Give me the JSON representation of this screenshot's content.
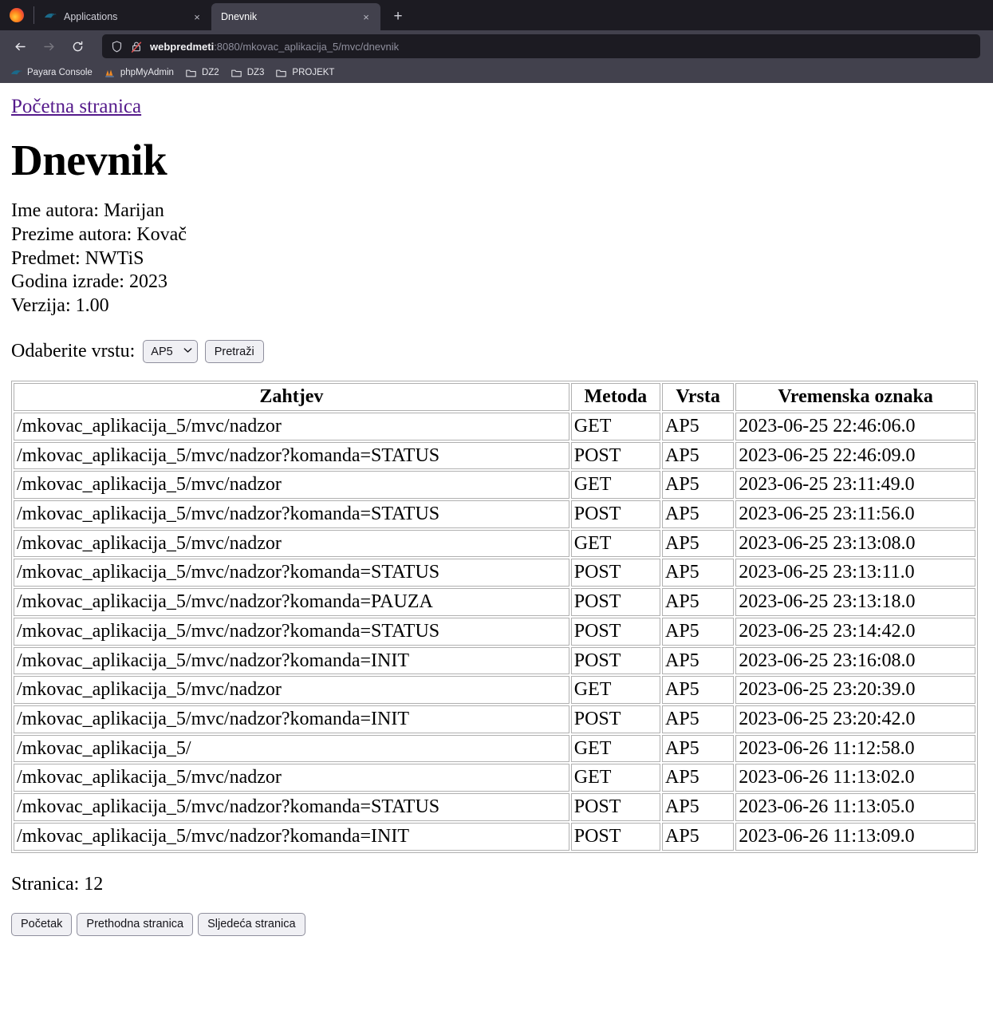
{
  "browser": {
    "app_icon": "firefox-logo",
    "tabs": [
      {
        "title": "Applications",
        "favicon": "payara-favicon",
        "active": false,
        "close_label": "×"
      },
      {
        "title": "Dnevnik",
        "favicon": "none",
        "active": true,
        "close_label": "×"
      }
    ],
    "new_tab_label": "+",
    "nav": {
      "back": "back-arrow",
      "forward": "forward-arrow",
      "reload": "reload-icon"
    },
    "urlbar": {
      "host": "webpredmeti",
      "path": ":8080/mkovac_aplikacija_5/mvc/dnevnik",
      "full_url": "webpredmeti:8080/mkovac_aplikacija_5/mvc/dnevnik",
      "shield_icon": "shield-icon",
      "lock_icon": "lock-crossed-icon"
    },
    "bookmarks": [
      {
        "label": "Payara Console",
        "icon": "payara-icon"
      },
      {
        "label": "phpMyAdmin",
        "icon": "phpmyadmin-icon"
      },
      {
        "label": "DZ2",
        "icon": "folder-icon"
      },
      {
        "label": "DZ3",
        "icon": "folder-icon"
      },
      {
        "label": "PROJEKT",
        "icon": "folder-icon"
      }
    ],
    "colors": {
      "tabstrip_bg": "#1c1b22",
      "chrome_bg": "#42414d",
      "urlbar_bg": "#1c1b22",
      "active_tab_bg": "#42414d",
      "text": "#e8e8ed"
    }
  },
  "page": {
    "home_link": "Početna stranica",
    "title": "Dnevnik",
    "meta": [
      "Ime autora: Marijan",
      "Prezime autora: Kovač",
      "Predmet: NWTiS",
      "Godina izrade: 2023",
      "Verzija: 1.00"
    ],
    "link_color": "#551a8b",
    "search": {
      "label": "Odaberite vrstu:",
      "select_value": "AP5",
      "select_caret": "⌄",
      "submit_label": "Pretraži"
    },
    "table": {
      "headers": [
        "Zahtjev",
        "Metoda",
        "Vrsta",
        "Vremenska oznaka"
      ],
      "rows": [
        [
          "/mkovac_aplikacija_5/mvc/nadzor",
          "GET",
          "AP5",
          "2023-06-25 22:46:06.0"
        ],
        [
          "/mkovac_aplikacija_5/mvc/nadzor?komanda=STATUS",
          "POST",
          "AP5",
          "2023-06-25 22:46:09.0"
        ],
        [
          "/mkovac_aplikacija_5/mvc/nadzor",
          "GET",
          "AP5",
          "2023-06-25 23:11:49.0"
        ],
        [
          "/mkovac_aplikacija_5/mvc/nadzor?komanda=STATUS",
          "POST",
          "AP5",
          "2023-06-25 23:11:56.0"
        ],
        [
          "/mkovac_aplikacija_5/mvc/nadzor",
          "GET",
          "AP5",
          "2023-06-25 23:13:08.0"
        ],
        [
          "/mkovac_aplikacija_5/mvc/nadzor?komanda=STATUS",
          "POST",
          "AP5",
          "2023-06-25 23:13:11.0"
        ],
        [
          "/mkovac_aplikacija_5/mvc/nadzor?komanda=PAUZA",
          "POST",
          "AP5",
          "2023-06-25 23:13:18.0"
        ],
        [
          "/mkovac_aplikacija_5/mvc/nadzor?komanda=STATUS",
          "POST",
          "AP5",
          "2023-06-25 23:14:42.0"
        ],
        [
          "/mkovac_aplikacija_5/mvc/nadzor?komanda=INIT",
          "POST",
          "AP5",
          "2023-06-25 23:16:08.0"
        ],
        [
          "/mkovac_aplikacija_5/mvc/nadzor",
          "GET",
          "AP5",
          "2023-06-25 23:20:39.0"
        ],
        [
          "/mkovac_aplikacija_5/mvc/nadzor?komanda=INIT",
          "POST",
          "AP5",
          "2023-06-25 23:20:42.0"
        ],
        [
          "/mkovac_aplikacija_5/",
          "GET",
          "AP5",
          "2023-06-26 11:12:58.0"
        ],
        [
          "/mkovac_aplikacija_5/mvc/nadzor",
          "GET",
          "AP5",
          "2023-06-26 11:13:02.0"
        ],
        [
          "/mkovac_aplikacija_5/mvc/nadzor?komanda=STATUS",
          "POST",
          "AP5",
          "2023-06-26 11:13:05.0"
        ],
        [
          "/mkovac_aplikacija_5/mvc/nadzor?komanda=INIT",
          "POST",
          "AP5",
          "2023-06-26 11:13:09.0"
        ]
      ]
    },
    "page_indicator": "Stranica: 12",
    "pager": {
      "first": "Početak",
      "previous": "Prethodna stranica",
      "next": "Sljedeća stranica"
    }
  }
}
